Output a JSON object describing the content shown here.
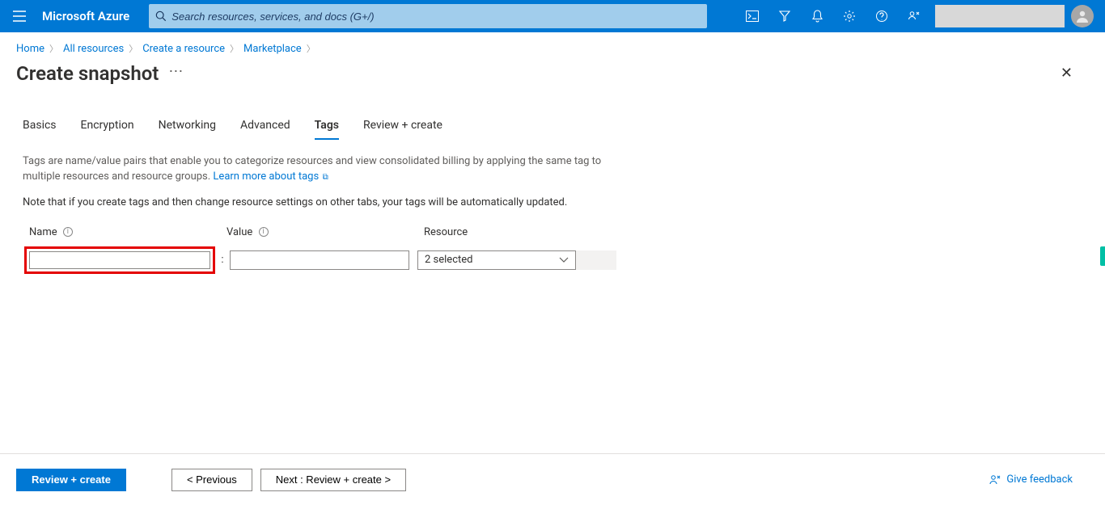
{
  "header": {
    "brand": "Microsoft Azure",
    "search_placeholder": "Search resources, services, and docs (G+/)"
  },
  "breadcrumb": {
    "items": [
      "Home",
      "All resources",
      "Create a resource",
      "Marketplace"
    ]
  },
  "page": {
    "title": "Create snapshot"
  },
  "tabs": {
    "items": [
      "Basics",
      "Encryption",
      "Networking",
      "Advanced",
      "Tags",
      "Review + create"
    ],
    "active": "Tags"
  },
  "body": {
    "desc_text": "Tags are name/value pairs that enable you to categorize resources and view consolidated billing by applying the same tag to multiple resources and resource groups. ",
    "learn_more": "Learn more about tags",
    "note": "Note that if you create tags and then change resource settings on other tabs, your tags will be automatically updated."
  },
  "tag_table": {
    "headers": {
      "name": "Name",
      "value": "Value",
      "resource": "Resource"
    },
    "row": {
      "name_value": "",
      "value_value": "",
      "resource_selected": "2 selected"
    }
  },
  "footer": {
    "review": "Review + create",
    "previous": "< Previous",
    "next": "Next : Review + create >",
    "feedback": "Give feedback"
  }
}
